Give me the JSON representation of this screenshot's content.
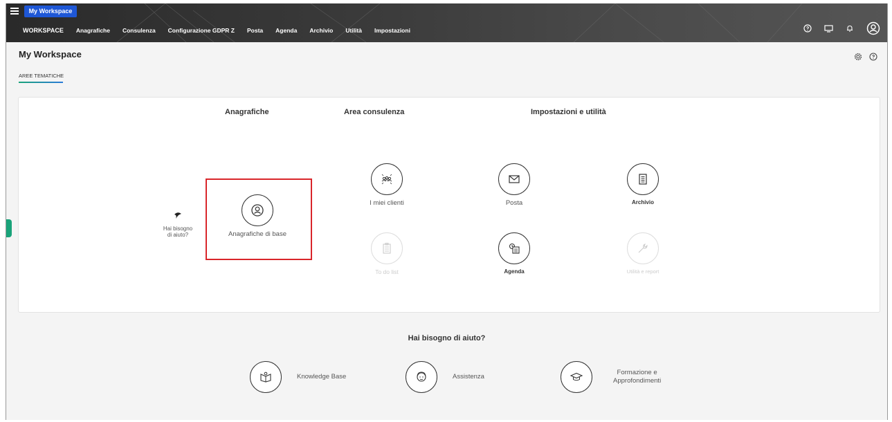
{
  "topbar": {
    "badge": "My Workspace",
    "nav": [
      "WORKSPACE",
      "Anagrafiche",
      "Consulenza",
      "Configurazione GDPR Z",
      "Posta",
      "Agenda",
      "Archivio",
      "Utilità",
      "Impostazioni"
    ]
  },
  "header": {
    "title": "My Workspace",
    "tab": "AREE TEMATICHE"
  },
  "card": {
    "col_anagrafiche": "Anagrafiche",
    "col_consulenza": "Area consulenza",
    "col_impostazioni": "Impostazioni e utilità",
    "help_line1": "Hai bisogno",
    "help_line2": "di aiuto?",
    "tiles": {
      "anagrafiche_base": "Anagrafiche di base",
      "miei_clienti": "I miei clienti",
      "todo": "To do list",
      "posta": "Posta",
      "agenda": "Agenda",
      "archivio": "Archivio",
      "utilita": "Utilità e report"
    }
  },
  "help": {
    "title": "Hai bisogno di aiuto?",
    "knowledge": "Knowledge Base",
    "assistenza": "Assistenza",
    "formazione_1": "Formazione e",
    "formazione_2": "Approfondimenti"
  },
  "colors": {
    "accent_blue": "#1e57d6",
    "highlight_red": "#d9252a",
    "teal": "#1aa37a"
  }
}
